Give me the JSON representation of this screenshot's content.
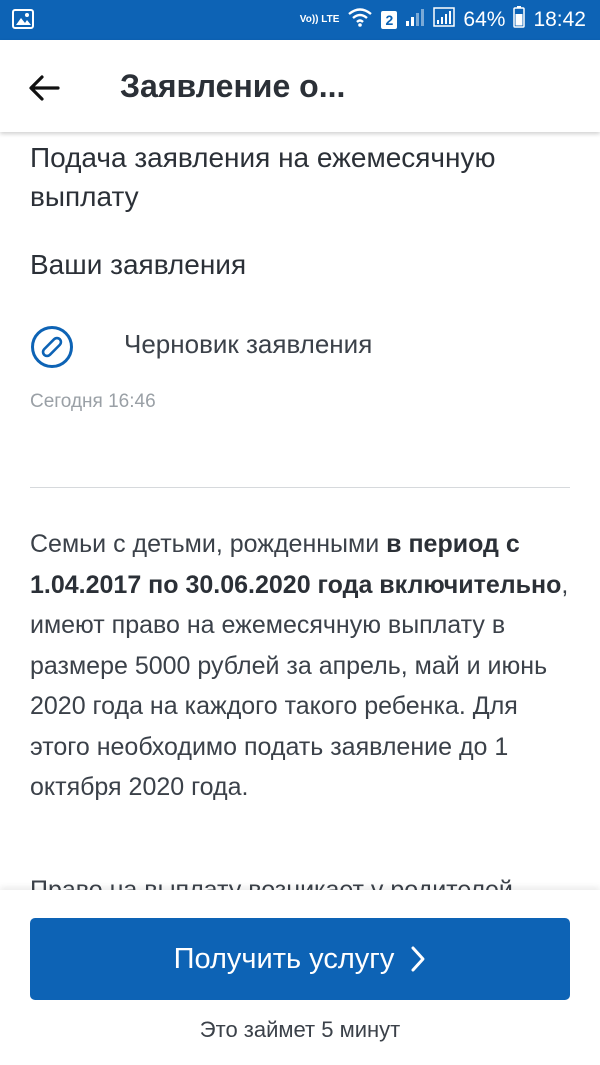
{
  "status_bar": {
    "volte": "Vo)) LTE",
    "sim_slot": "2",
    "battery": "64%",
    "time": "18:42"
  },
  "appbar": {
    "title": "Заявление о..."
  },
  "service": {
    "title": "Подача заявления на ежемесячную выплату"
  },
  "applications": {
    "heading": "Ваши заявления",
    "items": [
      {
        "status": "Черновик заявления",
        "time": "Сегодня 16:46"
      }
    ]
  },
  "info": {
    "p1_before": "Семьи с детьми, рожденными ",
    "p1_bold": "в период с 1.04.2017 по 30.06.2020 года включительно",
    "p1_after": ", имеют право на ежемесячную выплату в размере 5000 рублей за апрель, май и июнь 2020 года на каждого такого ребенка. Для этого необходимо подать заявление до 1 октября 2020 года.",
    "p2": "Право на выплату возникает у родителей"
  },
  "footer": {
    "cta_label": "Получить услугу",
    "note": "Это займет 5 минут"
  },
  "colors": {
    "primary": "#0d63b5",
    "text": "#333a42",
    "muted": "#9aa0a6"
  }
}
